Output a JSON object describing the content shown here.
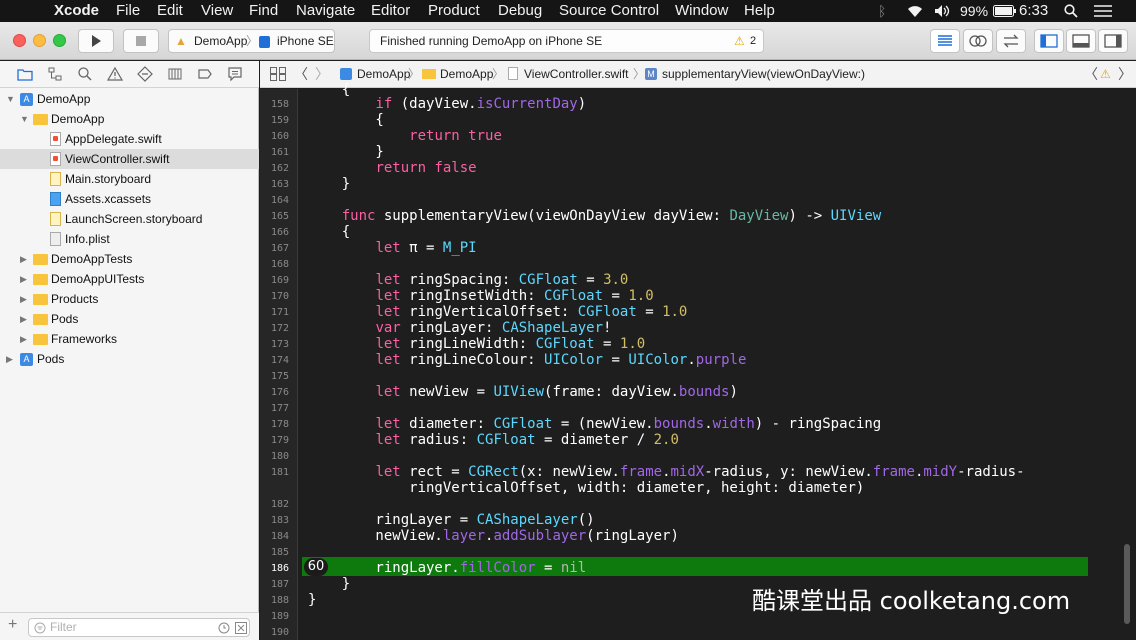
{
  "menubar": {
    "app": "Xcode",
    "items": [
      "File",
      "Edit",
      "View",
      "Find",
      "Navigate",
      "Editor",
      "Product",
      "Debug",
      "Source Control",
      "Window",
      "Help"
    ],
    "battery": "99%",
    "time": "6:33"
  },
  "toolbar": {
    "scheme_target": "DemoApp",
    "scheme_device": "iPhone SE",
    "activity": "Finished running DemoApp on iPhone SE",
    "warnings": "2"
  },
  "navigator": {
    "items": [
      {
        "label": "DemoApp",
        "kind": "project",
        "depth": 0,
        "disclosure": "open"
      },
      {
        "label": "DemoApp",
        "kind": "folder",
        "depth": 1,
        "disclosure": "open"
      },
      {
        "label": "AppDelegate.swift",
        "kind": "swift",
        "depth": 2
      },
      {
        "label": "ViewController.swift",
        "kind": "swift",
        "depth": 2,
        "selected": true
      },
      {
        "label": "Main.storyboard",
        "kind": "storyboard",
        "depth": 2
      },
      {
        "label": "Assets.xcassets",
        "kind": "assets",
        "depth": 2
      },
      {
        "label": "LaunchScreen.storyboard",
        "kind": "storyboard",
        "depth": 2
      },
      {
        "label": "Info.plist",
        "kind": "plist",
        "depth": 2
      },
      {
        "label": "DemoAppTests",
        "kind": "folder",
        "depth": 1,
        "disclosure": "closed"
      },
      {
        "label": "DemoAppUITests",
        "kind": "folder",
        "depth": 1,
        "disclosure": "closed"
      },
      {
        "label": "Products",
        "kind": "folder",
        "depth": 1,
        "disclosure": "closed"
      },
      {
        "label": "Pods",
        "kind": "folder",
        "depth": 1,
        "disclosure": "closed"
      },
      {
        "label": "Frameworks",
        "kind": "folder",
        "depth": 1,
        "disclosure": "closed"
      },
      {
        "label": "Pods",
        "kind": "project",
        "depth": 0,
        "disclosure": "closed"
      }
    ],
    "filter_placeholder": "Filter"
  },
  "jumpbar": {
    "project": "DemoApp",
    "folder": "DemoApp",
    "file": "ViewController.swift",
    "symbol": "supplementaryView(viewOnDayView:)"
  },
  "editor": {
    "line_numbers": [
      "158",
      "159",
      "160",
      "161",
      "162",
      "163",
      "164",
      "165",
      "166",
      "167",
      "168",
      "169",
      "170",
      "171",
      "172",
      "173",
      "174",
      "175",
      "176",
      "177",
      "178",
      "179",
      "180",
      "181",
      "",
      "182",
      "183",
      "184",
      "185",
      "186",
      "187",
      "188",
      "189",
      "190"
    ],
    "highlighted_line": "186",
    "badge": "60"
  },
  "watermark": "酷课堂出品 coolketang.com"
}
